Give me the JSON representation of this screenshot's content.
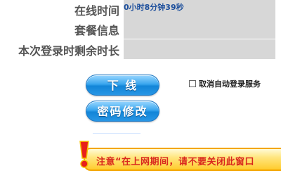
{
  "rows": {
    "online_time": {
      "label": "在线时间",
      "value": "0小时8分钟39秒"
    },
    "package_info": {
      "label": "套餐信息",
      "value": ""
    },
    "remaining_time": {
      "label": "本次登录时剩余时长",
      "value": ""
    }
  },
  "buttons": {
    "logout": "下 线",
    "change_password": "密码修改"
  },
  "auto_login": {
    "label": "取消自动登录服务",
    "checked": false
  },
  "notice": {
    "text": "注意“在上网期间，请不要关闭此窗口"
  },
  "colors": {
    "value_box": "#d7d7d7",
    "button_blue": "#1285d8",
    "notice_text": "#d9281e",
    "notice_bg": "#ffcc2e"
  },
  "icons": {
    "notice": "exclamation-icon"
  }
}
